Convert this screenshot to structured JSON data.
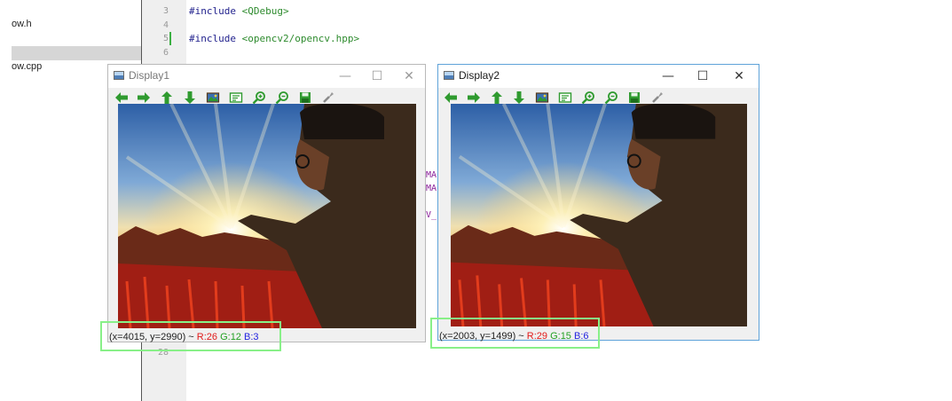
{
  "ide": {
    "files": [
      "ow.h",
      "ow.cpp"
    ],
    "line_numbers": [
      "3",
      "4",
      "5",
      "6",
      "28"
    ],
    "code": [
      {
        "kw": "#include ",
        "arg": "<QDebug>"
      },
      {
        "kw": "#include ",
        "arg": "<opencv2/opencv.hpp>"
      }
    ],
    "fragments": [
      "MA",
      "MA",
      "V_"
    ]
  },
  "windows": [
    {
      "title": "Display1",
      "controls": {
        "minimize": "—",
        "maximize": "☐",
        "close": "✕"
      },
      "toolbar": [
        "arrow-left-icon",
        "arrow-right-icon",
        "arrow-up-icon",
        "arrow-down-icon",
        "image-icon",
        "image-text-icon",
        "zoom-in-icon",
        "zoom-out-icon",
        "save-icon",
        "properties-icon"
      ],
      "status": {
        "coords": "(x=4015, y=2990) ~ ",
        "r": "R:26",
        "g": "G:12",
        "b": "B:3"
      }
    },
    {
      "title": "Display2",
      "controls": {
        "minimize": "—",
        "maximize": "☐",
        "close": "✕"
      },
      "toolbar": [
        "arrow-left-icon",
        "arrow-right-icon",
        "arrow-up-icon",
        "arrow-down-icon",
        "image-icon",
        "image-text-icon",
        "zoom-in-icon",
        "zoom-out-icon",
        "save-icon",
        "properties-icon"
      ],
      "status": {
        "coords": "(x=2003, y=1499) ~ ",
        "r": "R:29",
        "g": "G:15",
        "b": "B:6"
      }
    }
  ],
  "colors": {
    "highlight": "#88f088",
    "active_border": "#5fa3d9",
    "toolbar_green": "#2f9a2f",
    "red": "#e11b1b",
    "green": "#22a022",
    "blue": "#2323e0"
  }
}
